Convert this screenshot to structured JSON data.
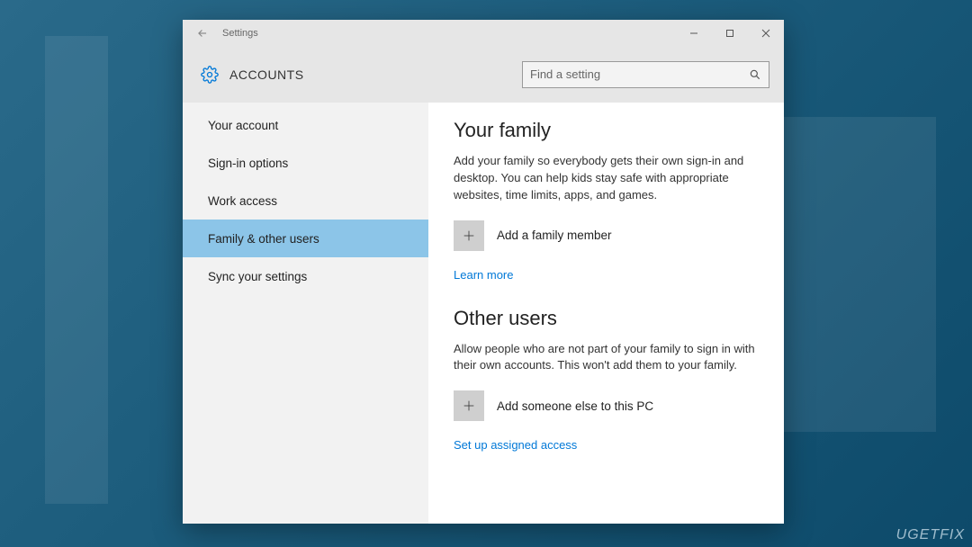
{
  "titlebar": {
    "app_name": "Settings"
  },
  "header": {
    "page_title": "ACCOUNTS",
    "search_placeholder": "Find a setting"
  },
  "sidebar": {
    "items": [
      {
        "label": "Your account"
      },
      {
        "label": "Sign-in options"
      },
      {
        "label": "Work access"
      },
      {
        "label": "Family & other users"
      },
      {
        "label": "Sync your settings"
      }
    ],
    "active_index": 3
  },
  "content": {
    "family": {
      "heading": "Your family",
      "description": "Add your family so everybody gets their own sign-in and desktop. You can help kids stay safe with appropriate websites, time limits, apps, and games.",
      "add_label": "Add a family member",
      "learn_more": "Learn more"
    },
    "other": {
      "heading": "Other users",
      "description": "Allow people who are not part of your family to sign in with their own accounts. This won't add them to your family.",
      "add_label": "Add someone else to this PC",
      "assigned_access": "Set up assigned access"
    }
  },
  "watermark": "UGETFIX"
}
